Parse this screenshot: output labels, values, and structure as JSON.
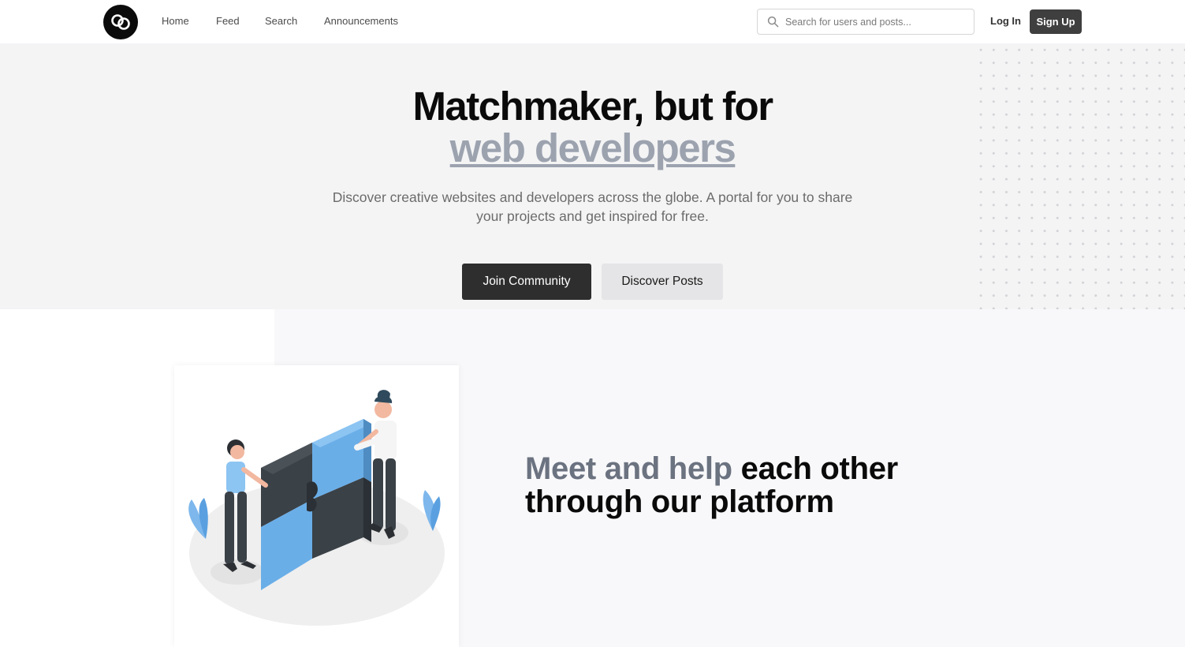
{
  "nav": {
    "links": [
      "Home",
      "Feed",
      "Search",
      "Announcements"
    ],
    "search_placeholder": "Search for users and posts...",
    "login": "Log In",
    "signup": "Sign Up"
  },
  "hero": {
    "title_line1": "Matchmaker, but for",
    "title_line2": "web developers",
    "subtitle": "Discover creative websites and developers across the globe. A portal for you to share your projects and get inspired for free.",
    "primary_button": "Join Community",
    "secondary_button": "Discover Posts"
  },
  "feature": {
    "heading_muted": "Meet and help",
    "heading_rest": "each other",
    "heading_line2": "through our platform"
  },
  "colors": {
    "accent_dark": "#2e2e2e",
    "muted_text": "#9ca3af",
    "hero_bg": "#f4f4f5"
  },
  "icons": [
    "logo-icon",
    "search-icon",
    "puzzle-illustration"
  ]
}
